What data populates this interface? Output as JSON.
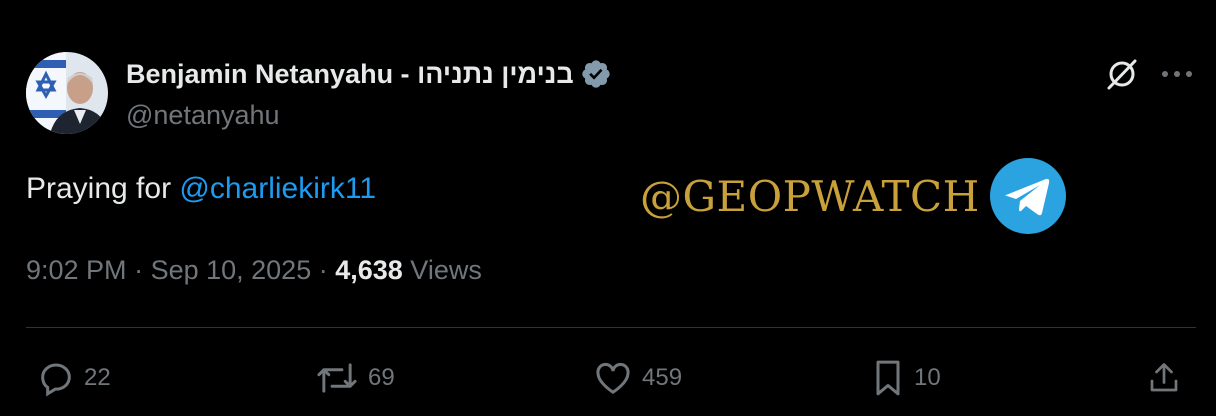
{
  "author": {
    "display_name": "Benjamin Netanyahu - בנימין נתניהו",
    "handle": "@netanyahu",
    "verified": true
  },
  "tweet": {
    "text_prefix": "Praying for ",
    "mention": "@charliekirk11"
  },
  "watermark": {
    "text": "@GEOPWATCH",
    "icon": "telegram-icon"
  },
  "meta": {
    "time": "9:02 PM",
    "separator1": " · ",
    "date": "Sep 10, 2025",
    "separator2": " · ",
    "views_count": "4,638",
    "views_label": " Views"
  },
  "actions": {
    "replies": "22",
    "reposts": "69",
    "likes": "459",
    "bookmarks": "10"
  },
  "colors": {
    "background": "#000000",
    "text": "#e7e9ea",
    "muted": "#71767b",
    "link": "#1d9bf0",
    "watermark": "#c9a13b",
    "telegram": "#2aa3e0"
  }
}
